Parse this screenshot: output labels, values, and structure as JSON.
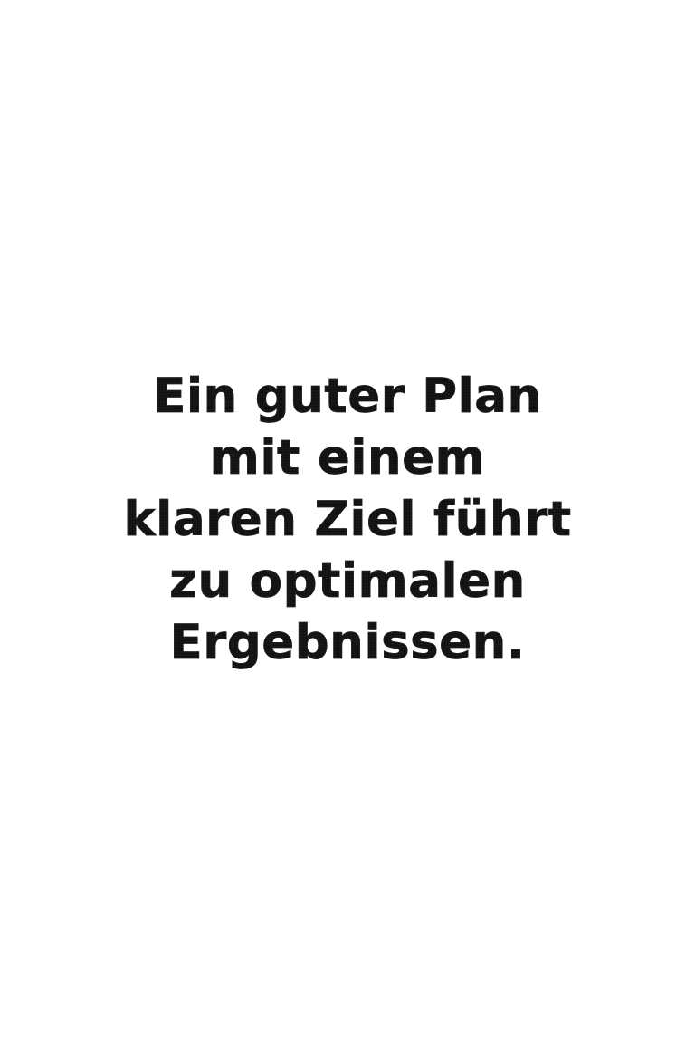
{
  "quote": {
    "lines": [
      "Ein guter Plan",
      "mit einem",
      "klaren Ziel führt",
      "zu optimalen",
      "Ergebnissen."
    ]
  },
  "colors": {
    "background": "#ffffff",
    "text": "#111111"
  }
}
